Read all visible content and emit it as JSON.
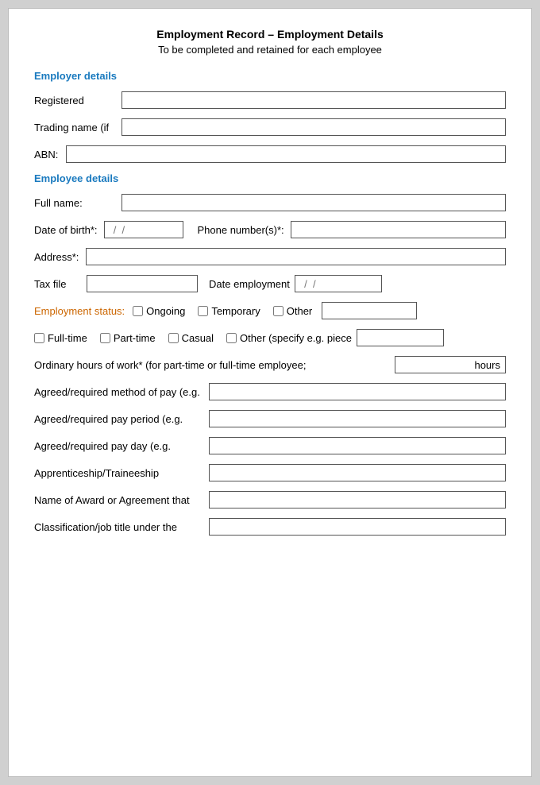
{
  "title": "Employment Record – Employment Details",
  "subtitle": "To be completed and retained for each employee",
  "sections": {
    "employer": {
      "header": "Employer details",
      "fields": {
        "registered_label": "Registered",
        "trading_name_label": "Trading name (if",
        "abn_label": "ABN:"
      }
    },
    "employee": {
      "header": "Employee details",
      "fields": {
        "full_name_label": "Full name:",
        "dob_label": "Date of birth*:",
        "dob_separator": "/",
        "phone_label": "Phone number(s)*:",
        "address_label": "Address*:",
        "tax_file_label": "Tax file",
        "date_employment_label": "Date employment",
        "status_label": "Employment status:",
        "ongoing_label": "Ongoing",
        "temporary_label": "Temporary",
        "other_label": "Other",
        "fulltime_label": "Full-time",
        "parttime_label": "Part-time",
        "casual_label": "Casual",
        "other_specify_label": "Other (specify e.g. piece",
        "hours_label": "Ordinary hours of work* (for part-time or full-time employee;",
        "hours_text": "hours",
        "method_label": "Agreed/required method of pay (e.g.",
        "pay_period_label": "Agreed/required pay period (e.g.",
        "pay_day_label": "Agreed/required pay day (e.g.",
        "apprentice_label": "Apprenticeship/Traineeship",
        "award_label": "Name of Award or Agreement that",
        "classification_label": "Classification/job title under the"
      }
    }
  }
}
